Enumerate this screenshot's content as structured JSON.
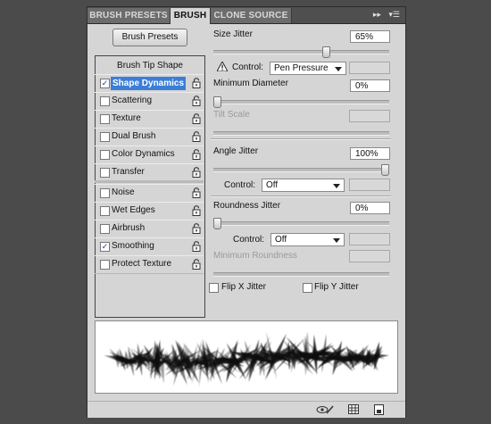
{
  "tabs": [
    {
      "label": "BRUSH PRESETS",
      "active": false
    },
    {
      "label": "BRUSH",
      "active": true
    },
    {
      "label": "CLONE SOURCE",
      "active": false
    }
  ],
  "tab_icons": [
    "collapse-arrows-icon",
    "panel-menu-icon"
  ],
  "brush_presets_button": "Brush Presets",
  "brush_tip_shape": "Brush Tip Shape",
  "options": [
    {
      "label": "Shape Dynamics",
      "checked": true,
      "selected": true
    },
    {
      "label": "Scattering",
      "checked": false
    },
    {
      "label": "Texture",
      "checked": false
    },
    {
      "label": "Dual Brush",
      "checked": false
    },
    {
      "label": "Color Dynamics",
      "checked": false
    },
    {
      "label": "Transfer",
      "checked": false
    },
    {
      "label": "Noise",
      "checked": false
    },
    {
      "label": "Wet Edges",
      "checked": false
    },
    {
      "label": "Airbrush",
      "checked": false
    },
    {
      "label": "Smoothing",
      "checked": true
    },
    {
      "label": "Protect Texture",
      "checked": false
    }
  ],
  "size_jitter": {
    "label": "Size Jitter",
    "value": "65%",
    "level": 0.65
  },
  "size_control": {
    "label": "Control:",
    "value": "Pen Pressure",
    "warning_icon": "warning-icon"
  },
  "minimum_diameter": {
    "label": "Minimum Diameter",
    "value": "0%",
    "level": 0
  },
  "tilt_scale": {
    "label": "Tilt Scale",
    "level": 0
  },
  "angle_jitter": {
    "label": "Angle Jitter",
    "value": "100%",
    "level": 1.0
  },
  "angle_control": {
    "label": "Control:",
    "value": "Off"
  },
  "roundness_jitter": {
    "label": "Roundness Jitter",
    "value": "0%",
    "level": 0
  },
  "roundness_control": {
    "label": "Control:",
    "value": "Off"
  },
  "minimum_roundness": {
    "label": "Minimum Roundness"
  },
  "flip_x": {
    "label": "Flip X Jitter",
    "checked": false
  },
  "flip_y": {
    "label": "Flip Y Jitter",
    "checked": false
  },
  "bottom_icons": [
    "eye-brush-icon",
    "grid-icon",
    "new-preset-icon"
  ],
  "colors": {
    "selection": "#3a7ed8",
    "panel": "#d5d5d5",
    "background": "#4b4b4b"
  }
}
